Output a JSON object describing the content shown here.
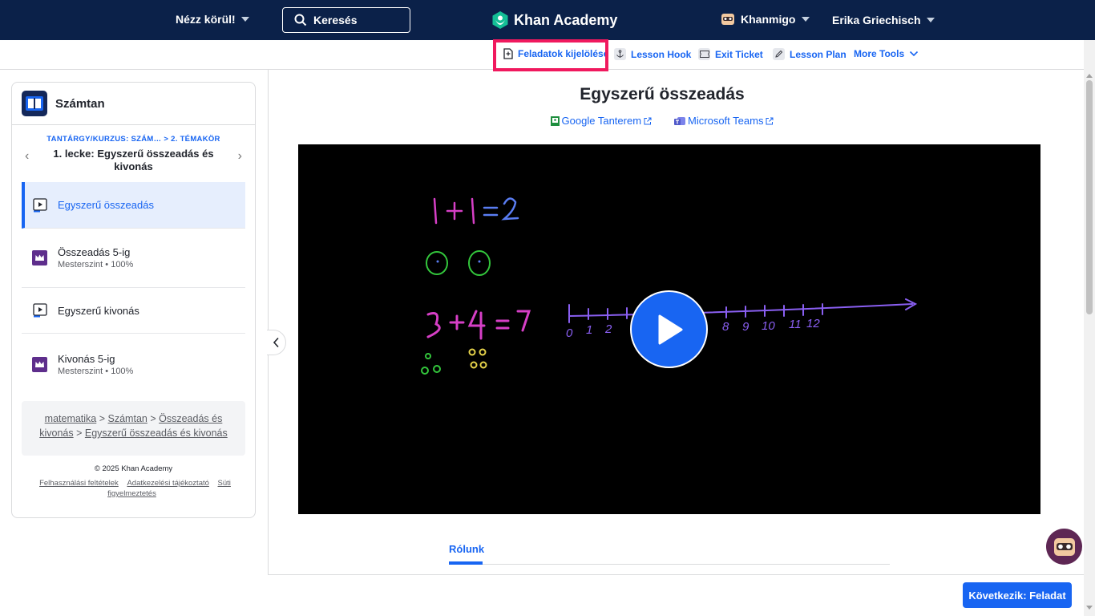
{
  "colors": {
    "nav_bg": "#0b2149",
    "accent": "#1865f2",
    "highlight": "#f0195e",
    "khanmigo": "#5e2754"
  },
  "topbar": {
    "explore_label": "Nézz körül!",
    "search_placeholder": "Keresés",
    "logo_text": "Khan Academy",
    "khanmigo_label": "Khanmigo",
    "user_name": "Erika Griechisch"
  },
  "tools": [
    {
      "label": "Feladatok kijelölése",
      "icon": "assignment-icon"
    },
    {
      "label": "Lesson Hook",
      "icon": "anchor-icon"
    },
    {
      "label": "Exit Ticket",
      "icon": "ticket-icon"
    },
    {
      "label": "Lesson Plan",
      "icon": "pencil-icon"
    },
    {
      "label": "More Tools",
      "icon": "chevron-down-icon"
    }
  ],
  "sidebar": {
    "course_title": "Számtan",
    "unit_crumb": "TANTÁRGY/KURZUS: SZÁM… > 2. TÉMAKÖR",
    "unit_title": "1. lecke: Egyszerű összeadás és kivonás",
    "items": [
      {
        "title": "Egyszerű összeadás",
        "sub": "",
        "type": "video"
      },
      {
        "title": "Összeadás 5-ig",
        "sub": "Mesterszint • 100%",
        "type": "practice"
      },
      {
        "title": "Egyszerű kivonás",
        "sub": "",
        "type": "video"
      },
      {
        "title": "Kivonás 5-ig",
        "sub": "Mesterszint • 100%",
        "type": "practice"
      }
    ],
    "breadcrumb": [
      "matematika",
      "Számtan",
      "Összeadás és kivonás",
      "Egyszerű összeadás és kivonás"
    ],
    "footer": {
      "copyright": "© 2025 Khan Academy",
      "links": [
        "Felhasználási feltételek",
        "Adatkezelési tájékoztató",
        "Süti figyelmeztetés"
      ]
    }
  },
  "main": {
    "title": "Egyszerű összeadás",
    "share": [
      "Google Tanterem",
      "Microsoft Teams"
    ],
    "tab_about": "Rólunk",
    "next_button": "Következik: Feladat"
  },
  "video": {
    "equation1": "1+1=2",
    "equation2": "3+4=7",
    "numberline_labels": [
      "0",
      "1",
      "2",
      "8",
      "9",
      "10",
      "11",
      "12"
    ]
  }
}
